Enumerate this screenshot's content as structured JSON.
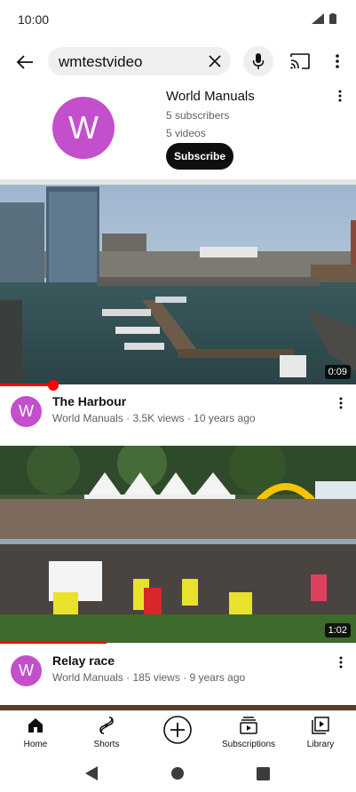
{
  "status": {
    "time": "10:00"
  },
  "search": {
    "query": "wmtestvideo"
  },
  "channel": {
    "avatar_letter": "W",
    "name": "World Manuals",
    "subscribers": "5 subscribers",
    "videos": "5 videos",
    "subscribe_label": "Subscribe"
  },
  "videos": [
    {
      "title": "The Harbour",
      "meta": "World Manuals · 3.5K views · 10 years ago",
      "duration": "0:09",
      "avatar_letter": "W",
      "watched_fraction": 0.15
    },
    {
      "title": "Relay race",
      "meta": "World Manuals · 185 views · 9 years ago",
      "duration": "1:02",
      "avatar_letter": "W"
    }
  ],
  "nav": {
    "items": [
      {
        "label": "Home",
        "icon": "home-icon"
      },
      {
        "label": "Shorts",
        "icon": "shorts-icon"
      },
      {
        "label": "",
        "icon": "create-icon"
      },
      {
        "label": "Subscriptions",
        "icon": "subscriptions-icon"
      },
      {
        "label": "Library",
        "icon": "library-icon"
      }
    ]
  },
  "colors": {
    "accent": "#FF0000",
    "avatar": "#C34FCD",
    "subscribe_bg": "#0F0F0F"
  }
}
